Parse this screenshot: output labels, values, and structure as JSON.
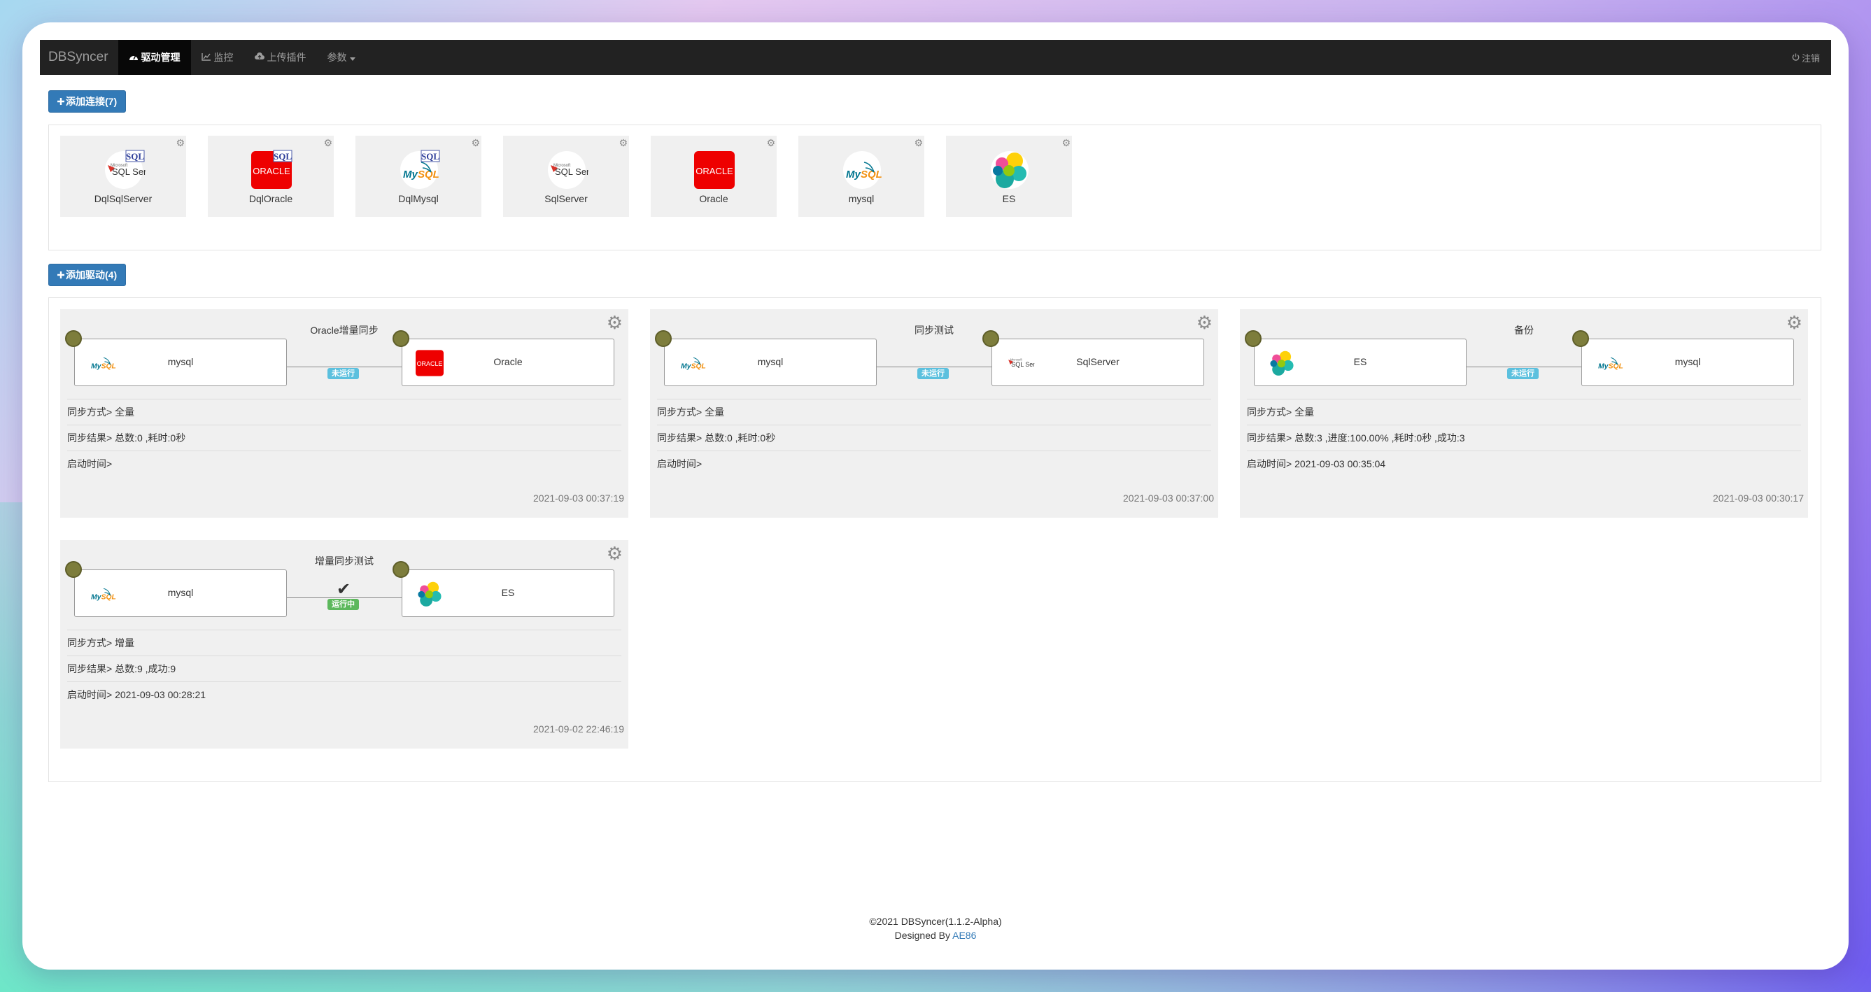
{
  "navbar": {
    "brand": "DBSyncer",
    "items": [
      {
        "label": "驱动管理",
        "icon": "dashboard-icon",
        "active": true
      },
      {
        "label": "监控",
        "icon": "line-chart-icon",
        "active": false
      },
      {
        "label": "上传插件",
        "icon": "cloud-upload-icon",
        "active": false
      },
      {
        "label": "参数",
        "icon": "caret-down-icon",
        "active": false
      }
    ],
    "logout_label": "注销"
  },
  "connections": {
    "add_button_label": "添加连接(7)",
    "items": [
      {
        "name": "DqlSqlServer",
        "logo": "dql-sqlserver-logo"
      },
      {
        "name": "DqlOracle",
        "logo": "dql-oracle-logo"
      },
      {
        "name": "DqlMysql",
        "logo": "dql-mysql-logo"
      },
      {
        "name": "SqlServer",
        "logo": "sqlserver-logo"
      },
      {
        "name": "Oracle",
        "logo": "oracle-logo"
      },
      {
        "name": "mysql",
        "logo": "mysql-logo"
      },
      {
        "name": "ES",
        "logo": "elasticsearch-logo"
      }
    ]
  },
  "drivers": {
    "add_button_label": "添加驱动(4)",
    "items": [
      {
        "title": "Oracle增量同步",
        "source": {
          "name": "mysql",
          "logo": "mysql-logo"
        },
        "target": {
          "name": "Oracle",
          "logo": "oracle-logo"
        },
        "status": "未运行",
        "running": false,
        "mode": "同步方式> 全量",
        "result": "同步结果> 总数:0 ,耗时:0秒",
        "start_time": "启动时间>",
        "timestamp": "2021-09-03 00:37:19"
      },
      {
        "title": "同步测试",
        "source": {
          "name": "mysql",
          "logo": "mysql-logo"
        },
        "target": {
          "name": "SqlServer",
          "logo": "sqlserver-logo"
        },
        "status": "未运行",
        "running": false,
        "mode": "同步方式> 全量",
        "result": "同步结果> 总数:0 ,耗时:0秒",
        "start_time": "启动时间>",
        "timestamp": "2021-09-03 00:37:00"
      },
      {
        "title": "备份",
        "source": {
          "name": "ES",
          "logo": "elasticsearch-logo"
        },
        "target": {
          "name": "mysql",
          "logo": "mysql-logo"
        },
        "status": "未运行",
        "running": false,
        "mode": "同步方式> 全量",
        "result": "同步结果> 总数:3 ,进度:100.00% ,耗时:0秒 ,成功:3",
        "start_time": "启动时间> 2021-09-03 00:35:04",
        "timestamp": "2021-09-03 00:30:17"
      },
      {
        "title": "增量同步测试",
        "source": {
          "name": "mysql",
          "logo": "mysql-logo"
        },
        "target": {
          "name": "ES",
          "logo": "elasticsearch-logo"
        },
        "status": "运行中",
        "running": true,
        "mode": "同步方式> 增量",
        "result": "同步结果> 总数:9 ,成功:9",
        "start_time": "启动时间> 2021-09-03 00:28:21",
        "timestamp": "2021-09-02 22:46:19"
      }
    ]
  },
  "footer": {
    "copyright": "©2021 DBSyncer(1.1.2-Alpha)",
    "designed_by": "Designed By",
    "author": "AE86"
  },
  "colors": {
    "navbar": "#222222",
    "primary": "#337ab7",
    "stopped_badge": "#5bc0de",
    "running_badge": "#5cb85c",
    "node_dot": "#7d7d3c"
  }
}
